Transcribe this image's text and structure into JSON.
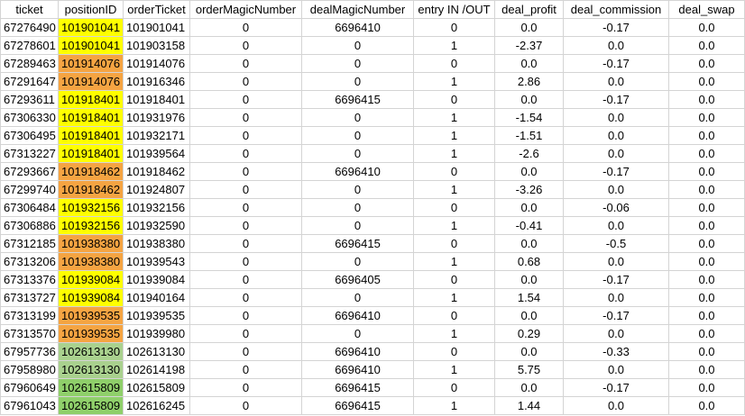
{
  "columns": [
    {
      "key": "ticket",
      "label": "ticket"
    },
    {
      "key": "positionID",
      "label": "positionID"
    },
    {
      "key": "orderTicket",
      "label": "orderTicket"
    },
    {
      "key": "orderMagicNumber",
      "label": "orderMagicNumber"
    },
    {
      "key": "dealMagicNumber",
      "label": "dealMagicNumber"
    },
    {
      "key": "entry",
      "label": "entry IN /OUT"
    },
    {
      "key": "deal_profit",
      "label": "deal_profit"
    },
    {
      "key": "deal_commission",
      "label": "deal_commission"
    },
    {
      "key": "deal_swap",
      "label": "deal_swap"
    }
  ],
  "highlight_colors": {
    "yellow": "#ffff00",
    "orange": "#f5a442",
    "lgreen": "#a9d18e",
    "green": "#8fcf6a"
  },
  "rows": [
    {
      "ticket": "67276490",
      "positionID": "101901041",
      "hl": "yellow",
      "orderTicket": "101901041",
      "orderMagicNumber": "0",
      "dealMagicNumber": "6696410",
      "entry": "0",
      "deal_profit": "0.0",
      "deal_commission": "-0.17",
      "deal_swap": "0.0"
    },
    {
      "ticket": "67278601",
      "positionID": "101901041",
      "hl": "yellow",
      "orderTicket": "101903158",
      "orderMagicNumber": "0",
      "dealMagicNumber": "0",
      "entry": "1",
      "deal_profit": "-2.37",
      "deal_commission": "0.0",
      "deal_swap": "0.0"
    },
    {
      "ticket": "67289463",
      "positionID": "101914076",
      "hl": "orange",
      "orderTicket": "101914076",
      "orderMagicNumber": "0",
      "dealMagicNumber": "0",
      "entry": "0",
      "deal_profit": "0.0",
      "deal_commission": "-0.17",
      "deal_swap": "0.0"
    },
    {
      "ticket": "67291647",
      "positionID": "101914076",
      "hl": "orange",
      "orderTicket": "101916346",
      "orderMagicNumber": "0",
      "dealMagicNumber": "0",
      "entry": "1",
      "deal_profit": "2.86",
      "deal_commission": "0.0",
      "deal_swap": "0.0"
    },
    {
      "ticket": "67293611",
      "positionID": "101918401",
      "hl": "yellow",
      "orderTicket": "101918401",
      "orderMagicNumber": "0",
      "dealMagicNumber": "6696415",
      "entry": "0",
      "deal_profit": "0.0",
      "deal_commission": "-0.17",
      "deal_swap": "0.0"
    },
    {
      "ticket": "67306330",
      "positionID": "101918401",
      "hl": "yellow",
      "orderTicket": "101931976",
      "orderMagicNumber": "0",
      "dealMagicNumber": "0",
      "entry": "1",
      "deal_profit": "-1.54",
      "deal_commission": "0.0",
      "deal_swap": "0.0"
    },
    {
      "ticket": "67306495",
      "positionID": "101918401",
      "hl": "yellow",
      "orderTicket": "101932171",
      "orderMagicNumber": "0",
      "dealMagicNumber": "0",
      "entry": "1",
      "deal_profit": "-1.51",
      "deal_commission": "0.0",
      "deal_swap": "0.0"
    },
    {
      "ticket": "67313227",
      "positionID": "101918401",
      "hl": "yellow",
      "orderTicket": "101939564",
      "orderMagicNumber": "0",
      "dealMagicNumber": "0",
      "entry": "1",
      "deal_profit": "-2.6",
      "deal_commission": "0.0",
      "deal_swap": "0.0"
    },
    {
      "ticket": "67293667",
      "positionID": "101918462",
      "hl": "orange",
      "orderTicket": "101918462",
      "orderMagicNumber": "0",
      "dealMagicNumber": "6696410",
      "entry": "0",
      "deal_profit": "0.0",
      "deal_commission": "-0.17",
      "deal_swap": "0.0"
    },
    {
      "ticket": "67299740",
      "positionID": "101918462",
      "hl": "orange",
      "orderTicket": "101924807",
      "orderMagicNumber": "0",
      "dealMagicNumber": "0",
      "entry": "1",
      "deal_profit": "-3.26",
      "deal_commission": "0.0",
      "deal_swap": "0.0"
    },
    {
      "ticket": "67306484",
      "positionID": "101932156",
      "hl": "yellow",
      "orderTicket": "101932156",
      "orderMagicNumber": "0",
      "dealMagicNumber": "0",
      "entry": "0",
      "deal_profit": "0.0",
      "deal_commission": "-0.06",
      "deal_swap": "0.0"
    },
    {
      "ticket": "67306886",
      "positionID": "101932156",
      "hl": "yellow",
      "orderTicket": "101932590",
      "orderMagicNumber": "0",
      "dealMagicNumber": "0",
      "entry": "1",
      "deal_profit": "-0.41",
      "deal_commission": "0.0",
      "deal_swap": "0.0"
    },
    {
      "ticket": "67312185",
      "positionID": "101938380",
      "hl": "orange",
      "orderTicket": "101938380",
      "orderMagicNumber": "0",
      "dealMagicNumber": "6696415",
      "entry": "0",
      "deal_profit": "0.0",
      "deal_commission": "-0.5",
      "deal_swap": "0.0"
    },
    {
      "ticket": "67313206",
      "positionID": "101938380",
      "hl": "orange",
      "orderTicket": "101939543",
      "orderMagicNumber": "0",
      "dealMagicNumber": "0",
      "entry": "1",
      "deal_profit": "0.68",
      "deal_commission": "0.0",
      "deal_swap": "0.0"
    },
    {
      "ticket": "67313376",
      "positionID": "101939084",
      "hl": "yellow",
      "orderTicket": "101939084",
      "orderMagicNumber": "0",
      "dealMagicNumber": "6696405",
      "entry": "0",
      "deal_profit": "0.0",
      "deal_commission": "-0.17",
      "deal_swap": "0.0"
    },
    {
      "ticket": "67313727",
      "positionID": "101939084",
      "hl": "yellow",
      "orderTicket": "101940164",
      "orderMagicNumber": "0",
      "dealMagicNumber": "0",
      "entry": "1",
      "deal_profit": "1.54",
      "deal_commission": "0.0",
      "deal_swap": "0.0"
    },
    {
      "ticket": "67313199",
      "positionID": "101939535",
      "hl": "orange",
      "orderTicket": "101939535",
      "orderMagicNumber": "0",
      "dealMagicNumber": "6696410",
      "entry": "0",
      "deal_profit": "0.0",
      "deal_commission": "-0.17",
      "deal_swap": "0.0"
    },
    {
      "ticket": "67313570",
      "positionID": "101939535",
      "hl": "orange",
      "orderTicket": "101939980",
      "orderMagicNumber": "0",
      "dealMagicNumber": "0",
      "entry": "1",
      "deal_profit": "0.29",
      "deal_commission": "0.0",
      "deal_swap": "0.0"
    },
    {
      "ticket": "67957736",
      "positionID": "102613130",
      "hl": "lgreen",
      "orderTicket": "102613130",
      "orderMagicNumber": "0",
      "dealMagicNumber": "6696410",
      "entry": "0",
      "deal_profit": "0.0",
      "deal_commission": "-0.33",
      "deal_swap": "0.0"
    },
    {
      "ticket": "67958980",
      "positionID": "102613130",
      "hl": "lgreen",
      "orderTicket": "102614198",
      "orderMagicNumber": "0",
      "dealMagicNumber": "6696410",
      "entry": "1",
      "deal_profit": "5.75",
      "deal_commission": "0.0",
      "deal_swap": "0.0"
    },
    {
      "ticket": "67960649",
      "positionID": "102615809",
      "hl": "green",
      "orderTicket": "102615809",
      "orderMagicNumber": "0",
      "dealMagicNumber": "6696415",
      "entry": "0",
      "deal_profit": "0.0",
      "deal_commission": "-0.17",
      "deal_swap": "0.0"
    },
    {
      "ticket": "67961043",
      "positionID": "102615809",
      "hl": "green",
      "orderTicket": "102616245",
      "orderMagicNumber": "0",
      "dealMagicNumber": "6696415",
      "entry": "1",
      "deal_profit": "1.44",
      "deal_commission": "0.0",
      "deal_swap": "0.0"
    }
  ]
}
